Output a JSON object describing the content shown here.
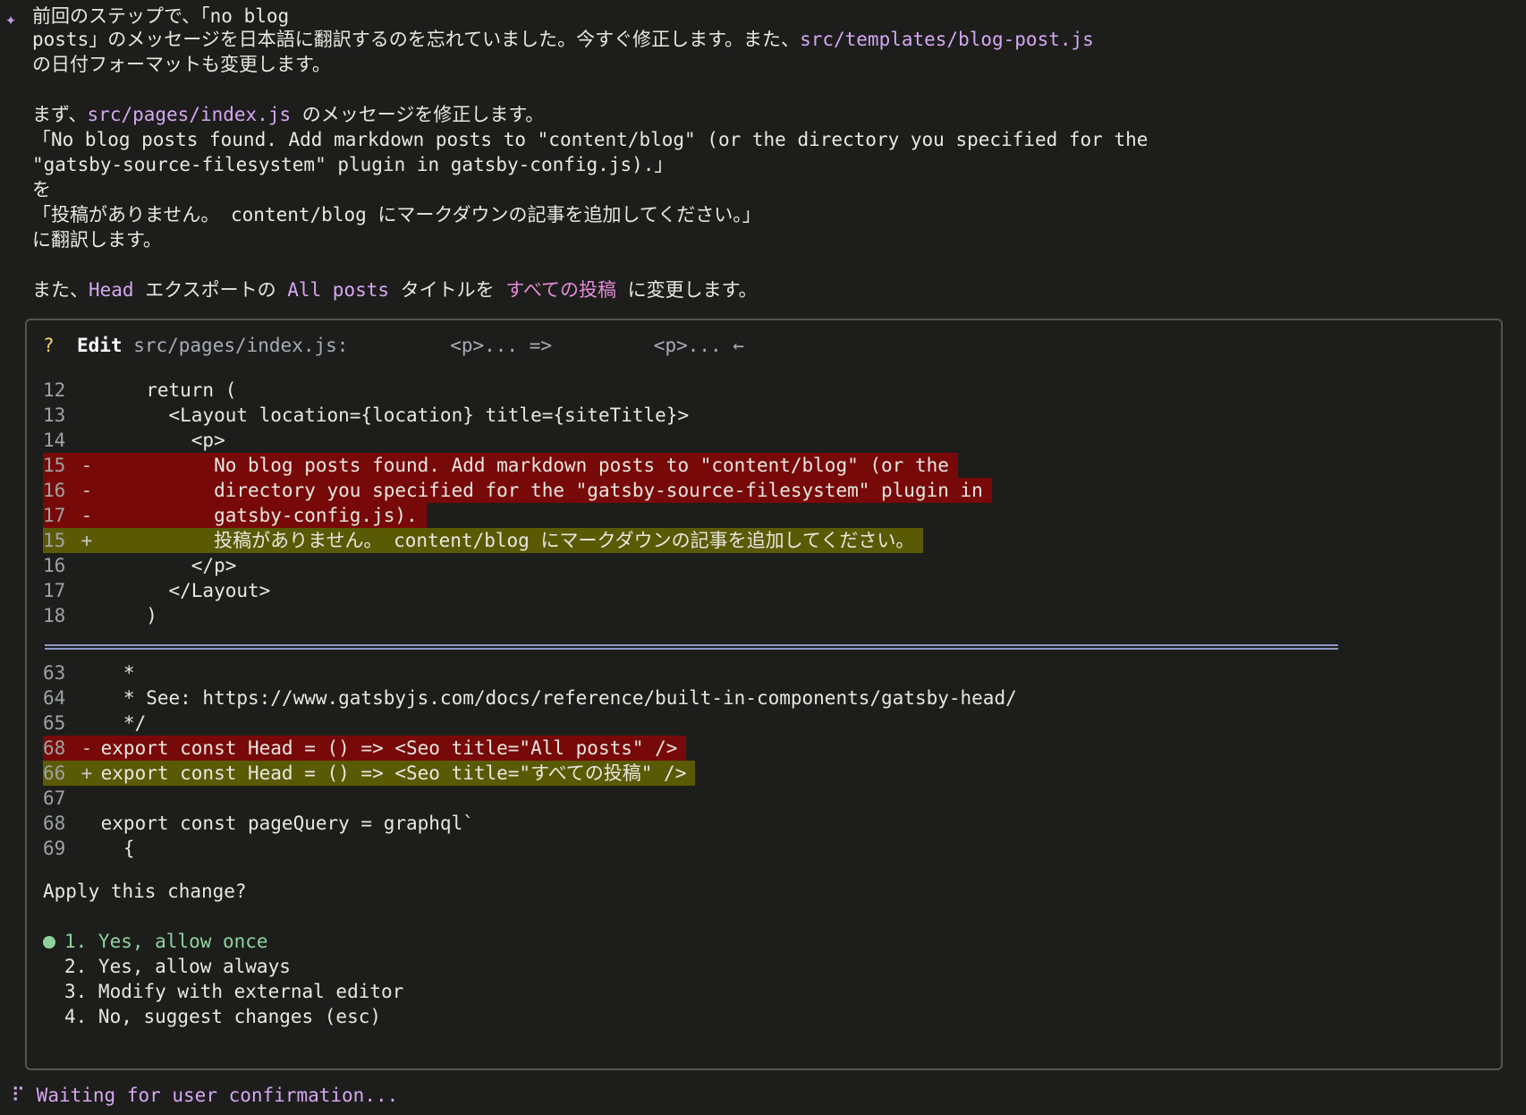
{
  "intro": {
    "line1": "前回のステップで、「no blog",
    "line2a": "posts」のメッセージを日本語に翻訳するのを忘れていました。今すぐ修正します。また、",
    "line2_path": "src/templates/blog-post.js",
    "line3": "の日付フォーマットも変更します。",
    "line5a": "まず、",
    "line5_path": "src/pages/index.js",
    "line5b": " のメッセージを修正します。",
    "line6": "「No blog posts found. Add markdown posts to \"content/blog\" (or the directory you specified for the",
    "line7": "\"gatsby-source-filesystem\" plugin in gatsby-config.js).」",
    "line8": "を",
    "line9": "「投稿がありません。 content/blog にマークダウンの記事を追加してください。」",
    "line10": "に翻訳します。",
    "line12a": "また、",
    "line12_head": "Head",
    "line12b": " エクスポートの ",
    "line12_allposts": "All posts",
    "line12c": " タイトルを ",
    "line12_jp": "すべての投稿",
    "line12d": " に変更します。"
  },
  "edit": {
    "question_mark": "?",
    "label": "Edit",
    "path": "src/pages/index.js:",
    "from": "<p>... =>",
    "to": "<p>... ←"
  },
  "diff1": [
    {
      "n": "12",
      "sign": "",
      "code": "    return ("
    },
    {
      "n": "13",
      "sign": "",
      "code": "      <Layout location={location} title={siteTitle}>"
    },
    {
      "n": "14",
      "sign": "",
      "code": "        <p>"
    },
    {
      "n": "15",
      "sign": "-",
      "code": "          No blog posts found. Add markdown posts to \"content/blog\" (or the"
    },
    {
      "n": "16",
      "sign": "-",
      "code": "          directory you specified for the \"gatsby-source-filesystem\" plugin in"
    },
    {
      "n": "17",
      "sign": "-",
      "code": "          gatsby-config.js)."
    },
    {
      "n": "15",
      "sign": "+",
      "code": "          投稿がありません。 content/blog にマークダウンの記事を追加してください。"
    },
    {
      "n": "16",
      "sign": "",
      "code": "        </p>"
    },
    {
      "n": "17",
      "sign": "",
      "code": "      </Layout>"
    },
    {
      "n": "18",
      "sign": "",
      "code": "    )"
    }
  ],
  "diff2": [
    {
      "n": "63",
      "sign": "",
      "code": "  *"
    },
    {
      "n": "64",
      "sign": "",
      "code": "  * See: https://www.gatsbyjs.com/docs/reference/built-in-components/gatsby-head/"
    },
    {
      "n": "65",
      "sign": "",
      "code": "  */"
    },
    {
      "n": "68",
      "sign": "-",
      "code": "export const Head = () => <Seo title=\"All posts\" />"
    },
    {
      "n": "66",
      "sign": "+",
      "code": "export const Head = () => <Seo title=\"すべての投稿\" />"
    },
    {
      "n": "67",
      "sign": "",
      "code": ""
    },
    {
      "n": "68",
      "sign": "",
      "code": "export const pageQuery = graphql`"
    },
    {
      "n": "69",
      "sign": "",
      "code": "  {"
    }
  ],
  "prompt": "Apply this change?",
  "options": [
    "1. Yes, allow once",
    "2. Yes, allow always",
    "3. Modify with external editor",
    "4. No, suggest changes (esc)"
  ],
  "status": "Waiting for user confirmation..."
}
